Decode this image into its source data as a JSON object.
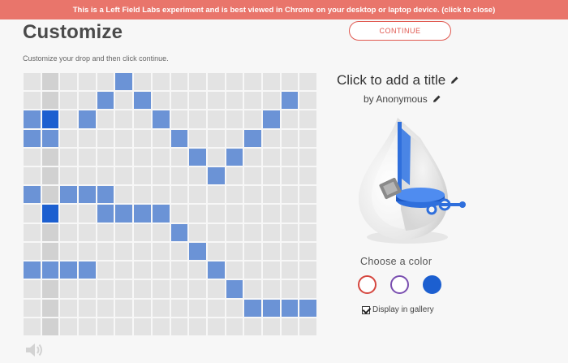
{
  "banner": {
    "text": "This is a Left Field Labs experiment and is best viewed in Chrome on your desktop or laptop device. (click to close)"
  },
  "header": {
    "title": "Customize",
    "subtitle": "Customize your drop and then click continue.",
    "continue_label": "CONTINUE"
  },
  "sequencer": {
    "columns": 16,
    "rows": 14,
    "active_cells": [
      [
        0,
        5
      ],
      [
        1,
        4
      ],
      [
        1,
        6
      ],
      [
        1,
        14
      ],
      [
        2,
        3
      ],
      [
        2,
        7
      ],
      [
        2,
        13
      ],
      [
        3,
        8
      ],
      [
        3,
        12
      ],
      [
        4,
        9
      ],
      [
        4,
        11
      ],
      [
        5,
        10
      ],
      [
        6,
        0
      ],
      [
        6,
        2
      ],
      [
        6,
        3
      ],
      [
        6,
        4
      ],
      [
        7,
        4
      ],
      [
        7,
        5
      ],
      [
        7,
        6
      ],
      [
        7,
        7
      ],
      [
        8,
        8
      ],
      [
        9,
        9
      ],
      [
        10,
        10
      ],
      [
        11,
        11
      ],
      [
        12,
        12
      ],
      [
        12,
        13
      ],
      [
        12,
        14
      ],
      [
        12,
        15
      ],
      [
        2,
        0
      ],
      [
        2,
        1
      ],
      [
        3,
        0
      ],
      [
        3,
        1
      ],
      [
        10,
        0
      ],
      [
        10,
        1
      ],
      [
        10,
        2
      ],
      [
        10,
        3
      ]
    ]
  },
  "drop": {
    "title": "Click to add a title",
    "author": "by Anonymous"
  },
  "colors": {
    "label": "Choose a color",
    "options": [
      "#d5473f",
      "#7a4fb0",
      "#1c5fd0"
    ],
    "selected": "#1c5fd0"
  },
  "gallery": {
    "label": "Display in gallery",
    "checked": true
  },
  "icons": {
    "speaker": "speaker-icon",
    "pencil": "pencil-icon"
  }
}
